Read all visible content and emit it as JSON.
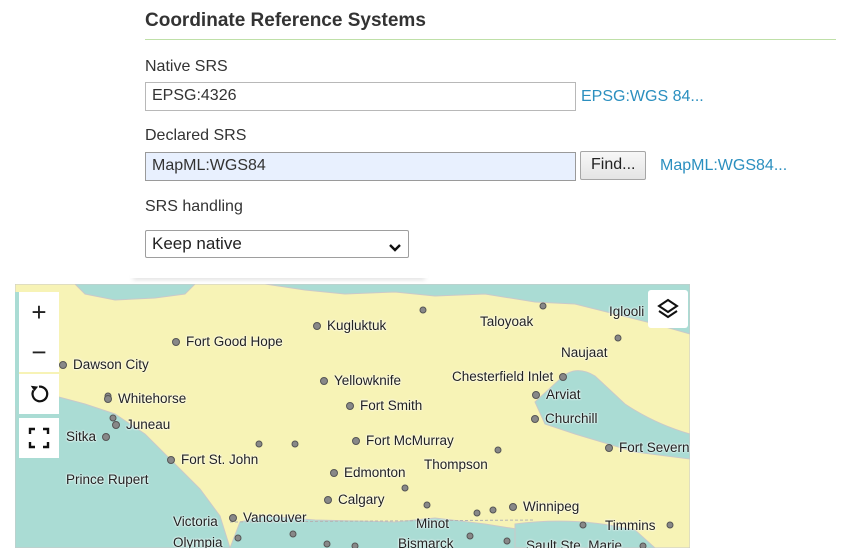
{
  "section": {
    "title": "Coordinate Reference Systems"
  },
  "native_srs": {
    "label": "Native SRS",
    "value": "EPSG:4326",
    "link": "EPSG:WGS 84..."
  },
  "declared_srs": {
    "label": "Declared SRS",
    "value": "MapML:WGS84",
    "find_label": "Find...",
    "link": "MapML:WGS84..."
  },
  "srs_handling": {
    "label": "SRS handling",
    "selected": "Keep native"
  },
  "map": {
    "controls": {
      "zoom_in": "+",
      "zoom_out": "−"
    },
    "cities": {
      "fort_good_hope": "Fort Good Hope",
      "kugluktuk": "Kugluktuk",
      "taloyoak": "Taloyoak",
      "iglooli": "Iglooli",
      "dawson_city": "Dawson City",
      "naujaat": "Naujaat",
      "yellowknife": "Yellowknife",
      "chesterfield_inlet": "Chesterfield Inlet",
      "whitehorse": "Whitehorse",
      "arviat": "Arviat",
      "fort_smith": "Fort Smith",
      "juneau": "Juneau",
      "churchill": "Churchill",
      "sitka": "Sitka",
      "fort_mcmurray": "Fort McMurray",
      "fort_severn": "Fort Severn",
      "fort_st_john": "Fort St. John",
      "thompson": "Thompson",
      "edmonton": "Edmonton",
      "prince_rupert": "Prince Rupert",
      "calgary": "Calgary",
      "winnipeg": "Winnipeg",
      "victoria": "Victoria",
      "vancouver": "Vancouver",
      "minot": "Minot",
      "timmins": "Timmins",
      "olympia": "Olympia",
      "bismarck": "Bismarck",
      "sault_ste_marie": "Sault Ste. Marie"
    },
    "colors": {
      "land": "#f7f3b6",
      "water": "#aadcd4",
      "border": "#c9c9c9"
    }
  }
}
